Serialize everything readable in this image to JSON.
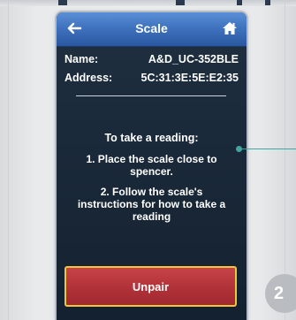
{
  "header": {
    "title": "Scale",
    "back_icon": "back-arrow-icon",
    "home_icon": "home-icon",
    "gradient_top": "#5b8fd6",
    "gradient_bottom": "#2b57a0"
  },
  "device": {
    "name_label": "Name:",
    "name_value": "A&D_UC-352BLE",
    "address_label": "Address:",
    "address_value": "5C:31:3E:5E:E2:35"
  },
  "instructions": {
    "heading": "To take a reading:",
    "step1": "1. Place the scale close to spencer.",
    "step2": "2. Follow the scale's instructions for how to take a reading"
  },
  "unpair_button": {
    "label": "Unpair",
    "color": "#b03238",
    "border_color": "#f2c63c"
  },
  "step_badge": {
    "number": "2"
  },
  "callout_color": "#3fa6a0"
}
